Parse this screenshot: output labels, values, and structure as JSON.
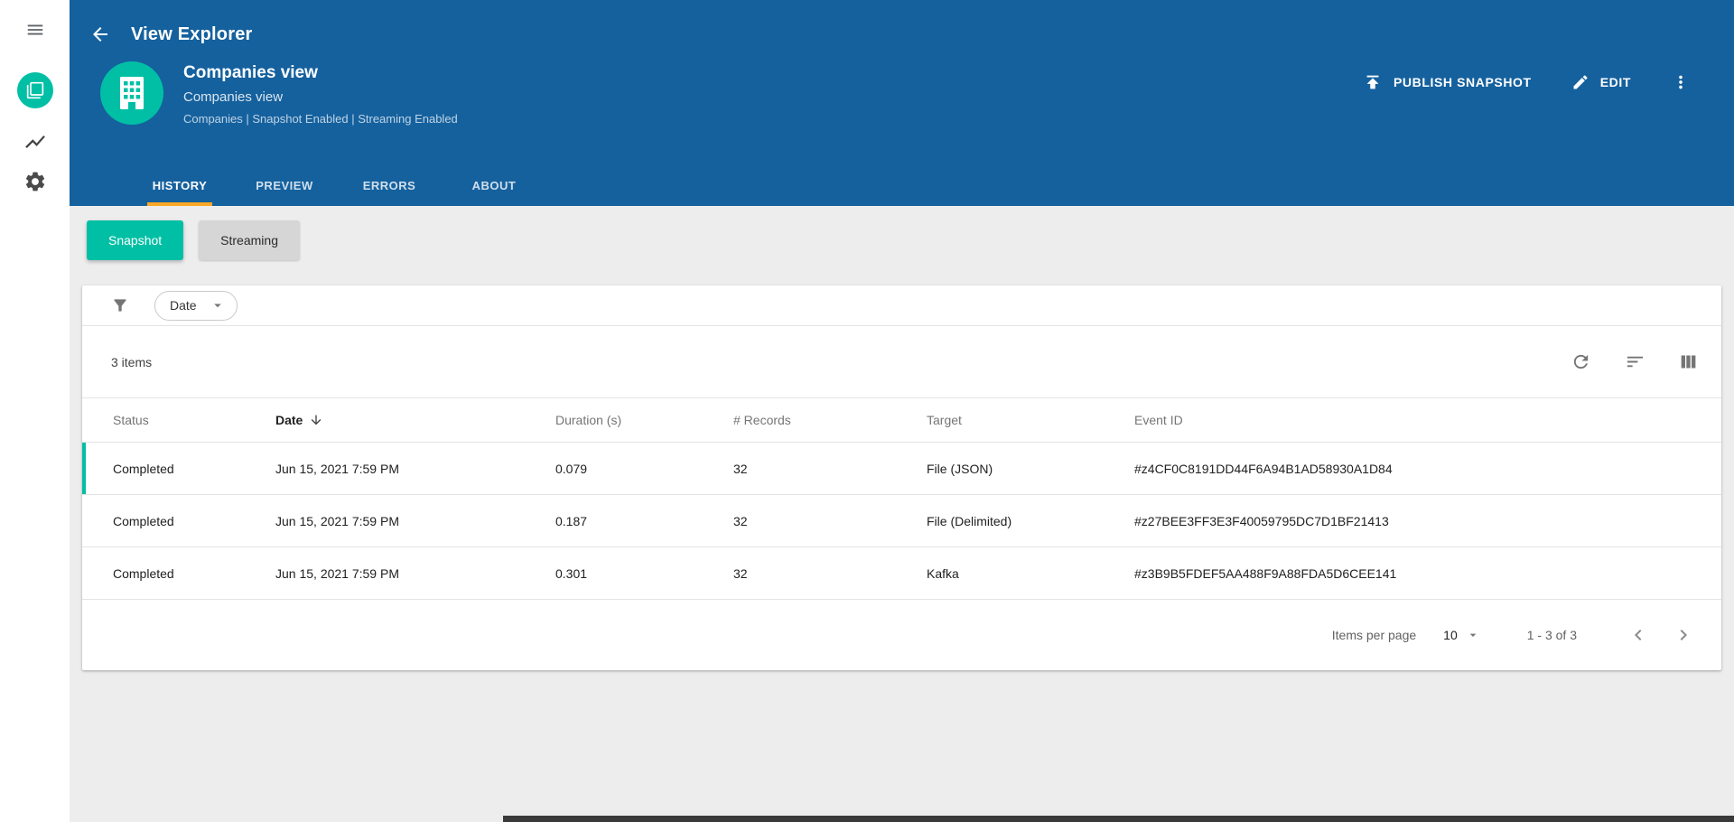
{
  "colors": {
    "header_blue": "#15619e",
    "accent_teal": "#00bfa5",
    "tab_underline": "#f9a825",
    "inactive_toggle_gray": "#d6d6d6"
  },
  "icons": {
    "sidebar": [
      "hamburger-menu",
      "app-logo-pages",
      "line-chart",
      "settings-gear"
    ],
    "back": "arrow-left",
    "avatar": "building",
    "publish": "upload-arrow",
    "edit": "pencil",
    "more": "kebab-vertical",
    "filter": "funnel",
    "dropdown_caret": "chevron-down",
    "refresh": "circular-arrow",
    "sort": "sort-lines",
    "columns": "column-bars",
    "date_sort": "arrow-down",
    "prev": "chevron-left",
    "next": "chevron-right"
  },
  "topbar": {
    "title": "View Explorer"
  },
  "entity": {
    "title": "Companies view",
    "subtitle": "Companies view",
    "meta": "Companies | Snapshot Enabled | Streaming Enabled"
  },
  "actions": {
    "publish_label": "PUBLISH SNAPSHOT",
    "edit_label": "EDIT"
  },
  "tabs": [
    {
      "label": "HISTORY",
      "active": true
    },
    {
      "label": "PREVIEW",
      "active": false
    },
    {
      "label": "ERRORS",
      "active": false
    },
    {
      "label": "ABOUT",
      "active": false
    }
  ],
  "toggles": {
    "snapshot_label": "Snapshot",
    "streaming_label": "Streaming"
  },
  "filter_bar": {
    "dropdown_label": "Date"
  },
  "grid": {
    "items_count": "3 items",
    "columns": [
      "Status",
      "Date",
      "Duration (s)",
      "# Records",
      "Target",
      "Event ID"
    ],
    "sorted_column": "Date",
    "sort_direction": "descending",
    "rows": [
      {
        "status": "Completed",
        "date": "Jun 15, 2021 7:59 PM",
        "duration": "0.079",
        "records": "32",
        "target": "File (JSON)",
        "event_id": "#z4CF0C8191DD44F6A94B1AD58930A1D84"
      },
      {
        "status": "Completed",
        "date": "Jun 15, 2021 7:59 PM",
        "duration": "0.187",
        "records": "32",
        "target": "File (Delimited)",
        "event_id": "#z27BEE3FF3E3F40059795DC7D1BF21413"
      },
      {
        "status": "Completed",
        "date": "Jun 15, 2021 7:59 PM",
        "duration": "0.301",
        "records": "32",
        "target": "Kafka",
        "event_id": "#z3B9B5FDEF5AA488F9A88FDA5D6CEE141"
      }
    ]
  },
  "pagination": {
    "label": "Items per page",
    "page_size": "10",
    "range": "1 - 3 of 3"
  }
}
